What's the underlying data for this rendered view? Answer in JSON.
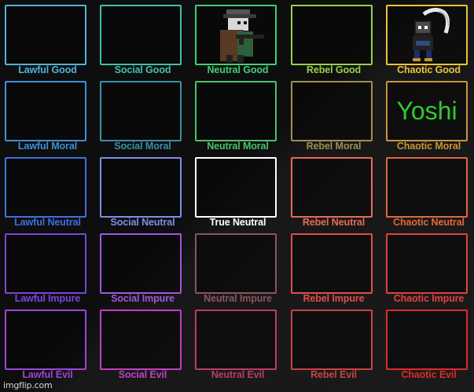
{
  "grid": {
    "rows": [
      {
        "cells": [
          {
            "label": "Lawful Good",
            "color": "#4fb3d9",
            "border": "#4fb3d9"
          },
          {
            "label": "Social Good",
            "color": "#3fc0ae",
            "border": "#3fc0ae"
          },
          {
            "label": "Neutral Good",
            "color": "#3fcf73",
            "border": "#3fcf73",
            "content": "character-sprite"
          },
          {
            "label": "Rebel Good",
            "color": "#96d14a",
            "border": "#96d14a"
          },
          {
            "label": "Chaotic Good",
            "color": "#e8c43a",
            "border": "#e8c43a",
            "content": "character-sprite"
          }
        ]
      },
      {
        "cells": [
          {
            "label": "Lawful Moral",
            "color": "#3f8fd6",
            "border": "#3f8fd6"
          },
          {
            "label": "Social Moral",
            "color": "#3b8fa8",
            "border": "#3b8fa8"
          },
          {
            "label": "Neutral Moral",
            "color": "#49c26a",
            "border": "#49c26a"
          },
          {
            "label": "Rebel Moral",
            "color": "#9c9053",
            "border": "#9c9053"
          },
          {
            "label": "Chaotic Moral",
            "color": "#c8953a",
            "border": "#c8953a",
            "text": "Yoshi",
            "text_color": "#32c832"
          }
        ]
      },
      {
        "cells": [
          {
            "label": "Lawful Neutral",
            "color": "#3f6fe0",
            "border": "#3f6fe0"
          },
          {
            "label": "Social Neutral",
            "color": "#7d8ee6",
            "border": "#7d8ee6"
          },
          {
            "label": "True Neutral",
            "color": "#ffffff",
            "border": "#ffffff"
          },
          {
            "label": "Rebel Neutral",
            "color": "#e36d55",
            "border": "#e36d55"
          },
          {
            "label": "Chaotic Neutral",
            "color": "#e0683e",
            "border": "#e0683e"
          }
        ]
      },
      {
        "cells": [
          {
            "label": "Lawful Impure",
            "color": "#7b45dd",
            "border": "#7b45dd"
          },
          {
            "label": "Social Impure",
            "color": "#a056dd",
            "border": "#a056dd"
          },
          {
            "label": "Neutral Impure",
            "color": "#8a5560",
            "border": "#8a5560"
          },
          {
            "label": "Rebel Impure",
            "color": "#e24d4d",
            "border": "#e24d4d"
          },
          {
            "label": "Chaotic Impure",
            "color": "#e04040",
            "border": "#e04040"
          }
        ]
      },
      {
        "cells": [
          {
            "label": "Lawful Evil",
            "color": "#9d45d6",
            "border": "#9d45d6"
          },
          {
            "label": "Social Evil",
            "color": "#c041bf",
            "border": "#c041bf"
          },
          {
            "label": "Neutral Evil",
            "color": "#b83f62",
            "border": "#b83f62"
          },
          {
            "label": "Rebel Evil",
            "color": "#c84343",
            "border": "#c84343"
          },
          {
            "label": "Chaotic Evil",
            "color": "#e02b2b",
            "border": "#e02b2b"
          }
        ]
      }
    ]
  },
  "watermark": "imgflip.com"
}
